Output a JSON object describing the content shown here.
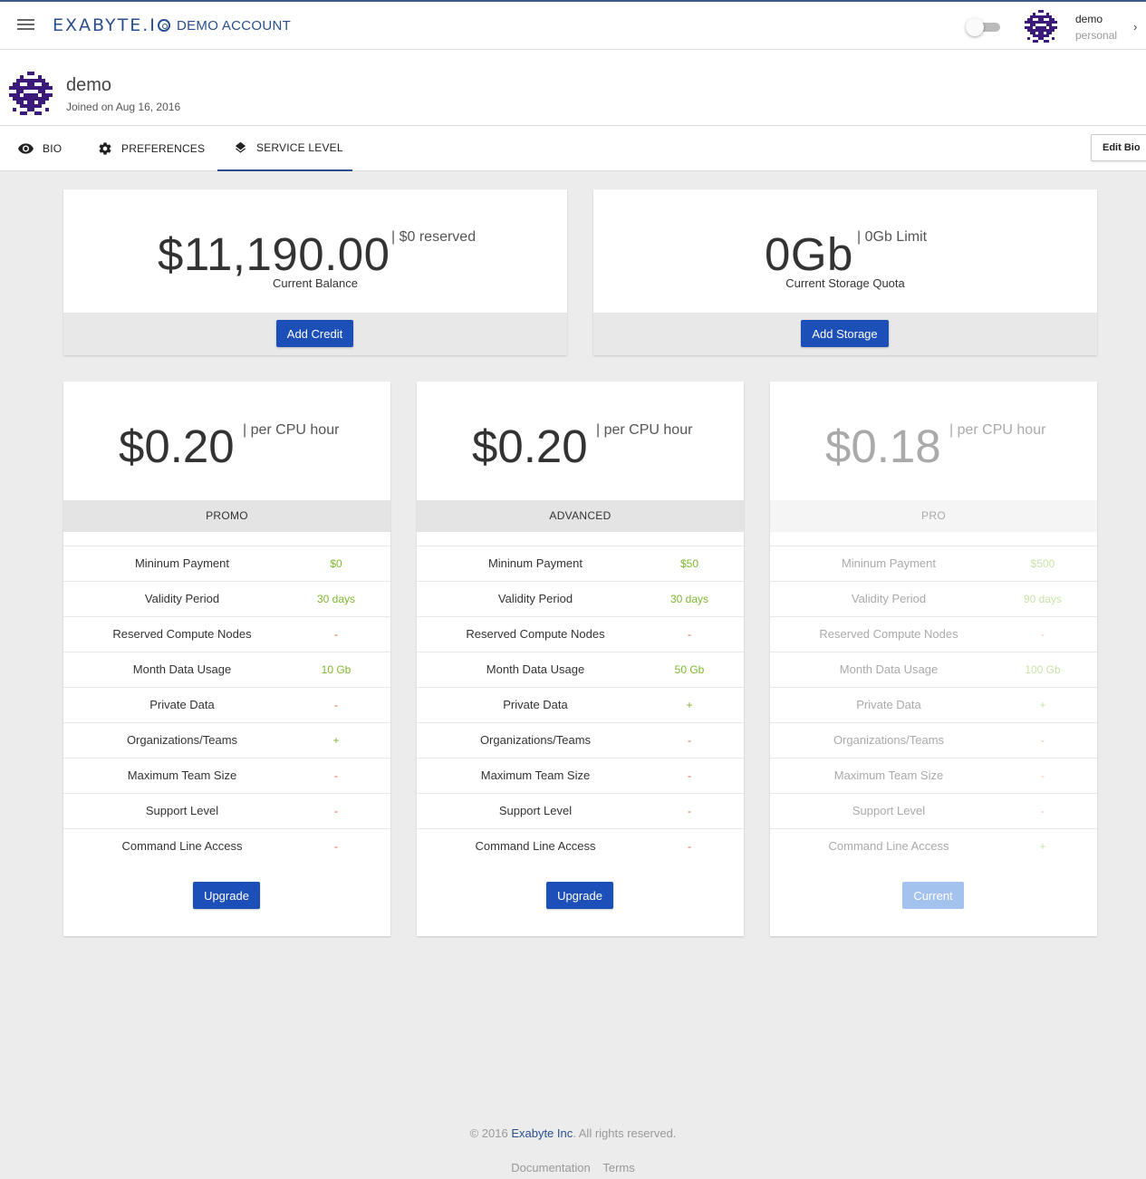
{
  "header": {
    "logo_text": "EXABYTE.I",
    "account_title": "DEMO ACCOUNT",
    "user_name": "demo",
    "user_sub": "personal",
    "toggle_on": false,
    "chevron_glyph": "›"
  },
  "profile": {
    "name": "demo",
    "joined": "Joined on Aug 16, 2016"
  },
  "tabs": [
    {
      "label": "BIO",
      "icon": "eye-icon",
      "active": false
    },
    {
      "label": "PREFERENCES",
      "icon": "gear-icon",
      "active": false
    },
    {
      "label": "SERVICE LEVEL",
      "icon": "layers-icon",
      "active": true
    }
  ],
  "edit_bio_label": "Edit Bio",
  "balance": {
    "value": "$11,190.00",
    "side": "| $0 reserved",
    "label": "Current Balance",
    "button": "Add Credit"
  },
  "storage": {
    "value": "0Gb",
    "side": "| 0Gb Limit",
    "label": "Current Storage Quota",
    "button": "Add Storage"
  },
  "colors": {
    "accent": "#1d4fb8",
    "brand": "#2a4f8f",
    "positive": "#7cb82f",
    "negative": "#e05d3a"
  },
  "plans": [
    {
      "price": "$0.20",
      "unit": "| per CPU hour",
      "name": "PROMO",
      "button": "Upgrade",
      "current": false,
      "rows": [
        {
          "feature": "Mininum Payment",
          "value": "$0"
        },
        {
          "feature": "Validity Period",
          "value": "30 days"
        },
        {
          "feature": "Reserved Compute Nodes",
          "value": "-"
        },
        {
          "feature": "Month Data Usage",
          "value": "10 Gb"
        },
        {
          "feature": "Private Data",
          "value": "-"
        },
        {
          "feature": "Organizations/Teams",
          "value": "+"
        },
        {
          "feature": "Maximum Team Size",
          "value": "-"
        },
        {
          "feature": "Support Level",
          "value": "-"
        },
        {
          "feature": "Command Line Access",
          "value": "-"
        }
      ]
    },
    {
      "price": "$0.20",
      "unit": "| per CPU hour",
      "name": "ADVANCED",
      "button": "Upgrade",
      "current": false,
      "rows": [
        {
          "feature": "Mininum Payment",
          "value": "$50"
        },
        {
          "feature": "Validity Period",
          "value": "30 days"
        },
        {
          "feature": "Reserved Compute Nodes",
          "value": "-"
        },
        {
          "feature": "Month Data Usage",
          "value": "50 Gb"
        },
        {
          "feature": "Private Data",
          "value": "+"
        },
        {
          "feature": "Organizations/Teams",
          "value": "-"
        },
        {
          "feature": "Maximum Team Size",
          "value": "-"
        },
        {
          "feature": "Support Level",
          "value": "-"
        },
        {
          "feature": "Command Line Access",
          "value": "-"
        }
      ]
    },
    {
      "price": "$0.18",
      "unit": "| per CPU hour",
      "name": "PRO",
      "button": "Current",
      "current": true,
      "rows": [
        {
          "feature": "Mininum Payment",
          "value": "$500"
        },
        {
          "feature": "Validity Period",
          "value": "90 days"
        },
        {
          "feature": "Reserved Compute Nodes",
          "value": "-"
        },
        {
          "feature": "Month Data Usage",
          "value": "100 Gb"
        },
        {
          "feature": "Private Data",
          "value": "+"
        },
        {
          "feature": "Organizations/Teams",
          "value": "-"
        },
        {
          "feature": "Maximum Team Size",
          "value": "-"
        },
        {
          "feature": "Support Level",
          "value": "-"
        },
        {
          "feature": "Command Line Access",
          "value": "+"
        }
      ]
    }
  ],
  "footer": {
    "copyright_prefix": "© 2016 ",
    "company": "Exabyte Inc",
    "copyright_suffix": ". All rights reserved.",
    "links": [
      "Documentation",
      "Terms"
    ]
  }
}
